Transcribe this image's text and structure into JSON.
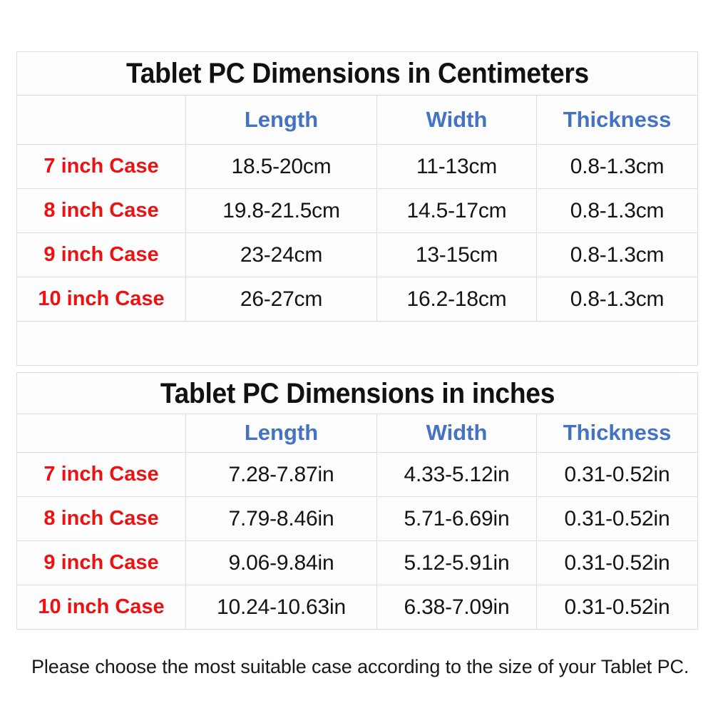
{
  "colors": {
    "header_blue": "#4472c4",
    "case_red": "#ee1111",
    "value_black": "#141414",
    "border_gray": "#dedede",
    "background": "#ffffff"
  },
  "tables": [
    {
      "title": "Tablet PC Dimensions in Centimeters",
      "columns": [
        "",
        "Length",
        "Width",
        "Thickness"
      ],
      "rows": [
        {
          "case": "7 inch Case",
          "length": "18.5-20cm",
          "width": "11-13cm",
          "thickness": "0.8-1.3cm"
        },
        {
          "case": "8 inch Case",
          "length": "19.8-21.5cm",
          "width": "14.5-17cm",
          "thickness": "0.8-1.3cm"
        },
        {
          "case": "9 inch Case",
          "length": "23-24cm",
          "width": "13-15cm",
          "thickness": "0.8-1.3cm"
        },
        {
          "case": "10 inch Case",
          "length": "26-27cm",
          "width": "16.2-18cm",
          "thickness": "0.8-1.3cm"
        }
      ]
    },
    {
      "title": "Tablet PC Dimensions in inches",
      "columns": [
        "",
        "Length",
        "Width",
        "Thickness"
      ],
      "rows": [
        {
          "case": "7 inch Case",
          "length": "7.28-7.87in",
          "width": "4.33-5.12in",
          "thickness": "0.31-0.52in"
        },
        {
          "case": "8 inch Case",
          "length": "7.79-8.46in",
          "width": "5.71-6.69in",
          "thickness": "0.31-0.52in"
        },
        {
          "case": "9 inch Case",
          "length": "9.06-9.84in",
          "width": "5.12-5.91in",
          "thickness": "0.31-0.52in"
        },
        {
          "case": "10 inch Case",
          "length": "10.24-10.63in",
          "width": "6.38-7.09in",
          "thickness": "0.31-0.52in"
        }
      ]
    }
  ],
  "caption": "Please choose the most suitable case according to the size of your Tablet PC."
}
